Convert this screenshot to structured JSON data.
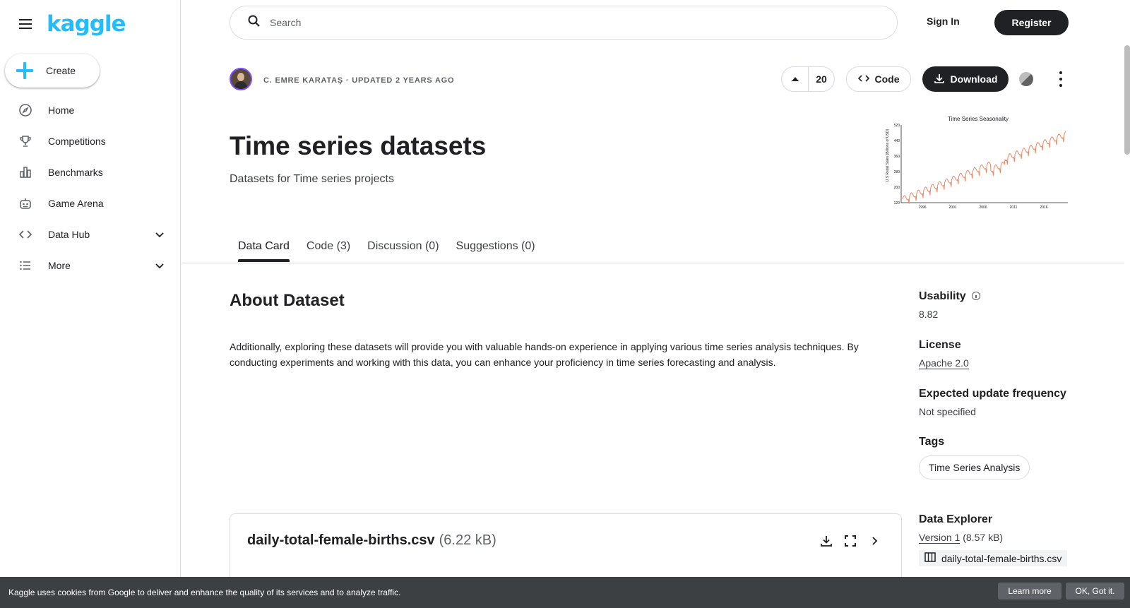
{
  "app": {
    "logo": "kaggle"
  },
  "sidebar": {
    "create_label": "Create",
    "items": [
      {
        "label": "Home",
        "icon": "compass-icon"
      },
      {
        "label": "Competitions",
        "icon": "trophy-icon"
      },
      {
        "label": "Benchmarks",
        "icon": "bar-chart-icon"
      },
      {
        "label": "Game Arena",
        "icon": "robot-icon"
      },
      {
        "label": "Data Hub",
        "icon": "code-icon"
      },
      {
        "label": "More",
        "icon": "list-icon"
      }
    ]
  },
  "header": {
    "search_placeholder": "Search",
    "sign_in": "Sign In",
    "register": "Register"
  },
  "dataset": {
    "meta": "C. EMRE KARATAŞ · UPDATED 2 YEARS AGO",
    "upvotes": "20",
    "code_label": "Code",
    "download_label": "Download",
    "title": "Time series datasets",
    "subtitle": "Datasets for Time series projects"
  },
  "thumbnail": {
    "title": "Time Series Seasonality",
    "ylabel": "U.S Retail Sales (Billions of USD)",
    "yticks": [
      "520",
      "440",
      "360",
      "280",
      "200",
      "120"
    ],
    "xticks": [
      "1996",
      "2001",
      "2006",
      "2011",
      "2016"
    ],
    "line_color": "#f4845f"
  },
  "tabs": [
    {
      "label": "Data Card",
      "active": true
    },
    {
      "label": "Code (3)",
      "active": false
    },
    {
      "label": "Discussion (0)",
      "active": false
    },
    {
      "label": "Suggestions (0)",
      "active": false
    }
  ],
  "about": {
    "title": "About Dataset",
    "text": "Additionally, exploring these datasets will provide you with valuable hands-on experience in applying various time series analysis techniques. By conducting experiments and working with this data, you can enhance your proficiency in time series forecasting and analysis."
  },
  "side_info": {
    "usability_label": "Usability",
    "usability_value": "8.82",
    "license_label": "License",
    "license_value": "Apache 2.0",
    "update_label": "Expected update frequency",
    "update_value": "Not specified",
    "tags_label": "Tags",
    "tag": "Time Series Analysis",
    "explorer_label": "Data Explorer",
    "version": "Version 1",
    "version_size": "(8.57 kB)",
    "file": "daily-total-female-births.csv"
  },
  "file_card": {
    "name": "daily-total-female-births.csv",
    "size": "(6.22 kB)"
  },
  "cookie": {
    "text": "Kaggle uses cookies from Google to deliver and enhance the quality of its services and to analyze traffic.",
    "learn_more": "Learn more",
    "ok": "OK, Got it."
  },
  "colors": {
    "brand": "#20beff",
    "dark": "#202124",
    "border": "#dadce0"
  }
}
